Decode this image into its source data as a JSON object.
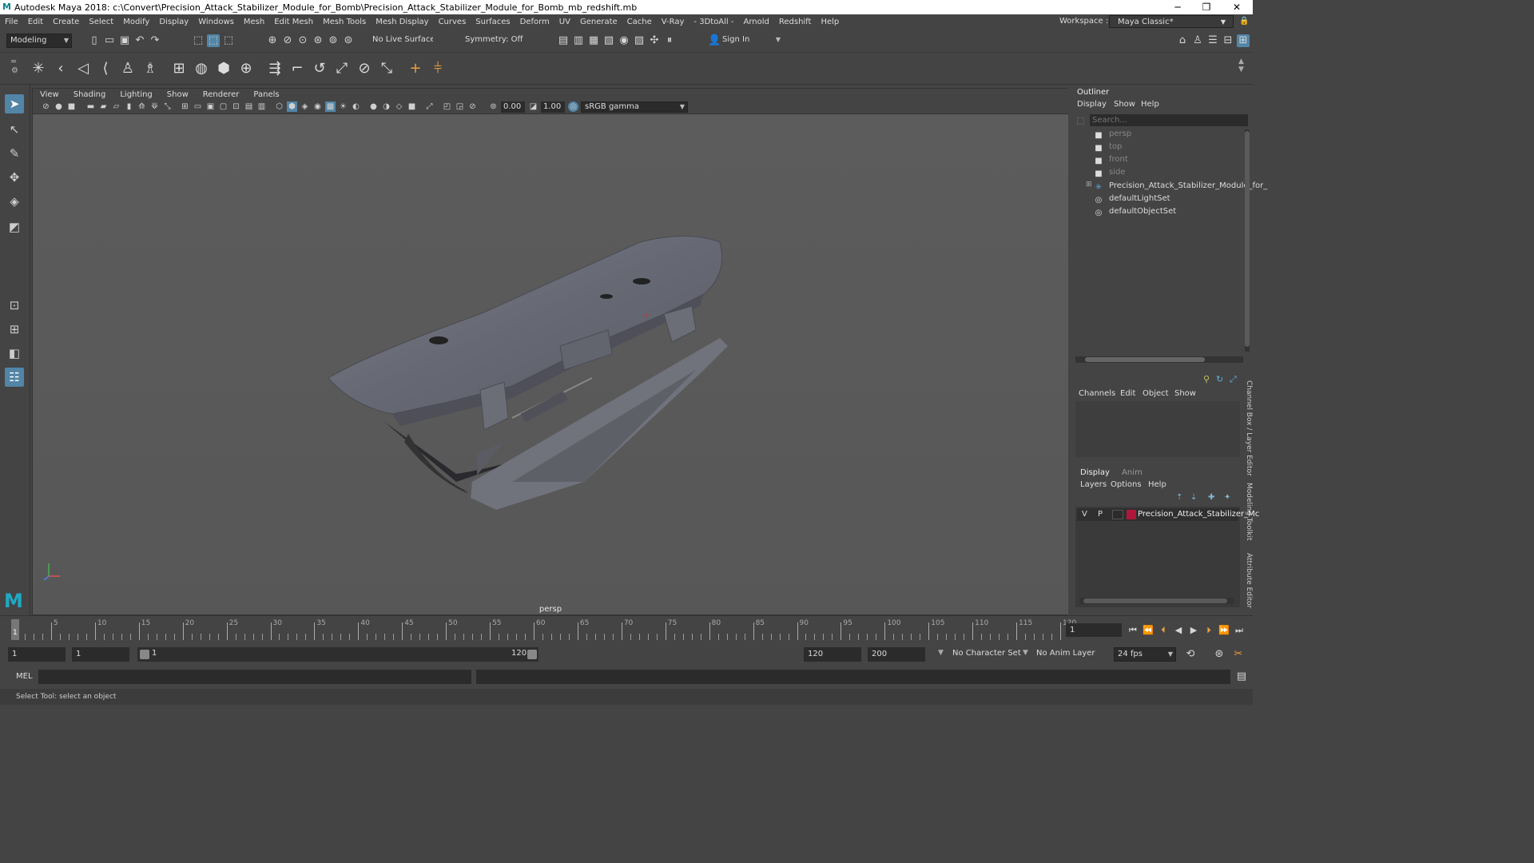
{
  "window": {
    "title": "Autodesk Maya 2018: c:\\Convert\\Precision_Attack_Stabilizer_Module_for_Bomb\\Precision_Attack_Stabilizer_Module_for_Bomb_mb_redshift.mb",
    "minimize": "─",
    "maximize": "❐",
    "close": "✕"
  },
  "menu": [
    "File",
    "Edit",
    "Create",
    "Select",
    "Modify",
    "Display",
    "Windows",
    "Mesh",
    "Edit Mesh",
    "Mesh Tools",
    "Mesh Display",
    "Curves",
    "Surfaces",
    "Deform",
    "UV",
    "Generate",
    "Cache",
    "V-Ray",
    "- 3DtoAll -",
    "Arnold",
    "Redshift",
    "Help"
  ],
  "workspace": {
    "label": "Workspace :",
    "value": "Maya Classic*"
  },
  "status": {
    "mode": "Modeling",
    "live_surface": "No Live Surface",
    "symmetry": "Symmetry: Off",
    "sign_in": "Sign In"
  },
  "panel_menu": [
    "View",
    "Shading",
    "Lighting",
    "Show",
    "Renderer",
    "Panels"
  ],
  "panel_toolbar": {
    "exposure": "0.00",
    "gamma": "1.00",
    "color_space": "sRGB gamma"
  },
  "viewport": {
    "camera": "persp"
  },
  "outliner": {
    "title": "Outliner",
    "menu": [
      "Display",
      "Show",
      "Help"
    ],
    "search_placeholder": "Search...",
    "items": [
      {
        "label": "persp",
        "dim": true
      },
      {
        "label": "top",
        "dim": true
      },
      {
        "label": "front",
        "dim": true
      },
      {
        "label": "side",
        "dim": true
      },
      {
        "label": "Precision_Attack_Stabilizer_Module_for_",
        "dim": false
      },
      {
        "label": "defaultLightSet",
        "dim": false
      },
      {
        "label": "defaultObjectSet",
        "dim": false
      }
    ]
  },
  "channel_box": {
    "menu": [
      "Channels",
      "Edit",
      "Object",
      "Show"
    ]
  },
  "layer_editor": {
    "tabs": [
      "Display",
      "Anim"
    ],
    "menu": [
      "Layers",
      "Options",
      "Help"
    ],
    "layer": {
      "v": "V",
      "p": "P",
      "name": "Precision_Attack_Stabilizer_Mc",
      "color": "#b0163a"
    }
  },
  "side_tabs": [
    "Channel Box / Layer Editor",
    "Modeling Toolkit",
    "Attribute Editor"
  ],
  "timeline": {
    "ticks": [
      "5",
      "10",
      "15",
      "20",
      "25",
      "30",
      "35",
      "40",
      "45",
      "50",
      "55",
      "60",
      "65",
      "70",
      "75",
      "80",
      "85",
      "90",
      "95",
      "100",
      "105",
      "110",
      "115",
      "120"
    ],
    "current_frame_marker": "1",
    "current_frame": "1"
  },
  "range": {
    "start": "1",
    "anim_start": "1",
    "slider_start": "1",
    "slider_end": "120",
    "end": "120",
    "anim_end": "200",
    "character_set": "No Character Set",
    "anim_layer": "No Anim Layer",
    "fps": "24 fps"
  },
  "command": {
    "label": "MEL"
  },
  "help": {
    "text": "Select Tool: select an object"
  }
}
